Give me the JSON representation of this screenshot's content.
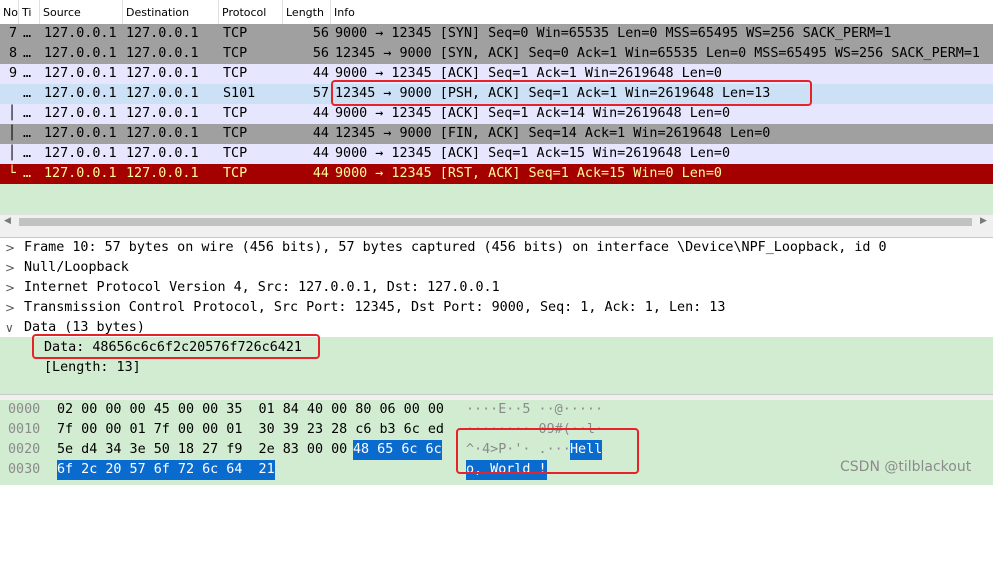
{
  "packet_list": {
    "columns": [
      "No",
      "Ti",
      "Source",
      "Destination",
      "Protocol",
      "Length",
      "Info"
    ],
    "rows": [
      {
        "no": "7",
        "time": "…",
        "src": "127.0.0.1",
        "dst": "127.0.0.1",
        "proto": "TCP",
        "len": "56",
        "info": "9000 → 12345 [SYN] Seq=0 Win=65535 Len=0 MSS=65495 WS=256 SACK_PERM=1",
        "bg": "#a0a0a0",
        "fg": "#000000"
      },
      {
        "no": "8",
        "time": "…",
        "src": "127.0.0.1",
        "dst": "127.0.0.1",
        "proto": "TCP",
        "len": "56",
        "info": "12345 → 9000 [SYN, ACK] Seq=0 Ack=1 Win=65535 Len=0 MSS=65495 WS=256 SACK_PERM=1",
        "bg": "#a0a0a0",
        "fg": "#000000"
      },
      {
        "no": "9",
        "time": "…",
        "src": "127.0.0.1",
        "dst": "127.0.0.1",
        "proto": "TCP",
        "len": "44",
        "info": "9000 → 12345 [ACK] Seq=1 Ack=1 Win=2619648 Len=0",
        "bg": "#e7e6ff",
        "fg": "#000000"
      },
      {
        "no": "",
        "time": "…",
        "src": "127.0.0.1",
        "dst": "127.0.0.1",
        "proto": "S101",
        "len": "57",
        "info": "12345 → 9000 [PSH, ACK] Seq=1 Ack=1 Win=2619648 Len=13",
        "bg": "#cce0f6",
        "fg": "#000000"
      },
      {
        "no": "",
        "time": "…",
        "src": "127.0.0.1",
        "dst": "127.0.0.1",
        "proto": "TCP",
        "len": "44",
        "info": "9000 → 12345 [ACK] Seq=1 Ack=14 Win=2619648 Len=0",
        "bg": "#e7e6ff",
        "fg": "#000000"
      },
      {
        "no": "",
        "time": "…",
        "src": "127.0.0.1",
        "dst": "127.0.0.1",
        "proto": "TCP",
        "len": "44",
        "info": "12345 → 9000 [FIN, ACK] Seq=14 Ack=1 Win=2619648 Len=0",
        "bg": "#a0a0a0",
        "fg": "#000000"
      },
      {
        "no": "",
        "time": "…",
        "src": "127.0.0.1",
        "dst": "127.0.0.1",
        "proto": "TCP",
        "len": "44",
        "info": "9000 → 12345 [ACK] Seq=1 Ack=15 Win=2619648 Len=0",
        "bg": "#e7e6ff",
        "fg": "#000000"
      },
      {
        "no": "",
        "time": "…",
        "src": "127.0.0.1",
        "dst": "127.0.0.1",
        "proto": "TCP",
        "len": "44",
        "info": "9000 → 12345 [RST, ACK] Seq=1 Ack=15 Win=0 Len=0",
        "bg": "#a40000",
        "fg": "#fffc9c"
      }
    ],
    "tree_glyphs": [
      "",
      "",
      "",
      "",
      "│",
      "│",
      "│",
      "└"
    ]
  },
  "details": {
    "items": [
      {
        "arrow": ">",
        "text": "Frame 10: 57 bytes on wire (456 bits), 57 bytes captured (456 bits) on interface \\Device\\NPF_Loopback, id 0"
      },
      {
        "arrow": ">",
        "text": "Null/Loopback"
      },
      {
        "arrow": ">",
        "text": "Internet Protocol Version 4, Src: 127.0.0.1, Dst: 127.0.0.1"
      },
      {
        "arrow": ">",
        "text": "Transmission Control Protocol, Src Port: 12345, Dst Port: 9000, Seq: 1, Ack: 1, Len: 13"
      },
      {
        "arrow": "∨",
        "text": "Data (13 bytes)"
      }
    ],
    "data_value": "Data: 48656c6c6f2c20576f726c6421",
    "data_length": "[Length: 13]"
  },
  "hex": {
    "rows": [
      {
        "offset": "0000",
        "bytes": "02 00 00 00 45 00 00 35  01 84 40 00 80 06 00 00",
        "ascii": "····E··5 ··@·····"
      },
      {
        "offset": "0010",
        "bytes": "7f 00 00 01 7f 00 00 01  30 39 23 28 c6 b3 6c ed",
        "ascii": "········ 09#(··l·"
      },
      {
        "offset": "0020",
        "bytes": "5e d4 34 3e 50 18 27 f9  2e 83 00 00 ",
        "bytes_hl": "48 65 6c 6c",
        "ascii": "^·4>P·'· .···",
        "ascii_hl": "Hell"
      },
      {
        "offset": "0030",
        "bytes": "",
        "bytes_hl": "6f 2c 20 57 6f 72 6c 64  21",
        "ascii": "",
        "ascii_hl": "o, World !"
      }
    ]
  },
  "watermark": "CSDN @tilblackout",
  "colors": {
    "tcp_gray": "#a0a0a0",
    "tcp_light": "#e7e6ff",
    "selected": "#cce0f6",
    "rst_red": "#a40000",
    "pane_green": "#d2ecd2",
    "byte_highlight": "#0a6bcf",
    "annotation_red": "#e6222a"
  }
}
